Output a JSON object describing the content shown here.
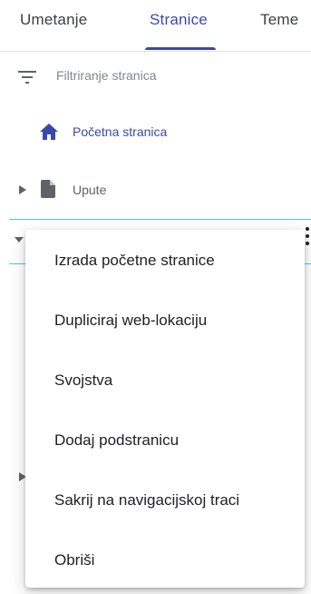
{
  "tabs": [
    {
      "label": "Umetanje",
      "selected": false
    },
    {
      "label": "Stranice",
      "selected": true
    },
    {
      "label": "Teme",
      "selected": false
    }
  ],
  "filter": {
    "placeholder": "Filtriranje stranica",
    "icon": "filter-icon"
  },
  "pages": [
    {
      "label": "Početna stranica",
      "icon": "home-icon",
      "is_home": true
    },
    {
      "label": "Upute",
      "icon": "document-icon",
      "collapsed": true
    }
  ],
  "context_menu": {
    "items": [
      {
        "label": "Izrada početne stranice"
      },
      {
        "label": "Dupliciraj web-lokaciju"
      },
      {
        "label": "Svojstva"
      },
      {
        "label": "Dodaj podstranicu"
      },
      {
        "label": "Sakrij na navigacijskoj traci"
      },
      {
        "label": "Obriši"
      }
    ]
  },
  "colors": {
    "accent": "#3949ab",
    "selection_border": "#4fc3f7",
    "text": "#202124",
    "muted": "#5f6368"
  }
}
